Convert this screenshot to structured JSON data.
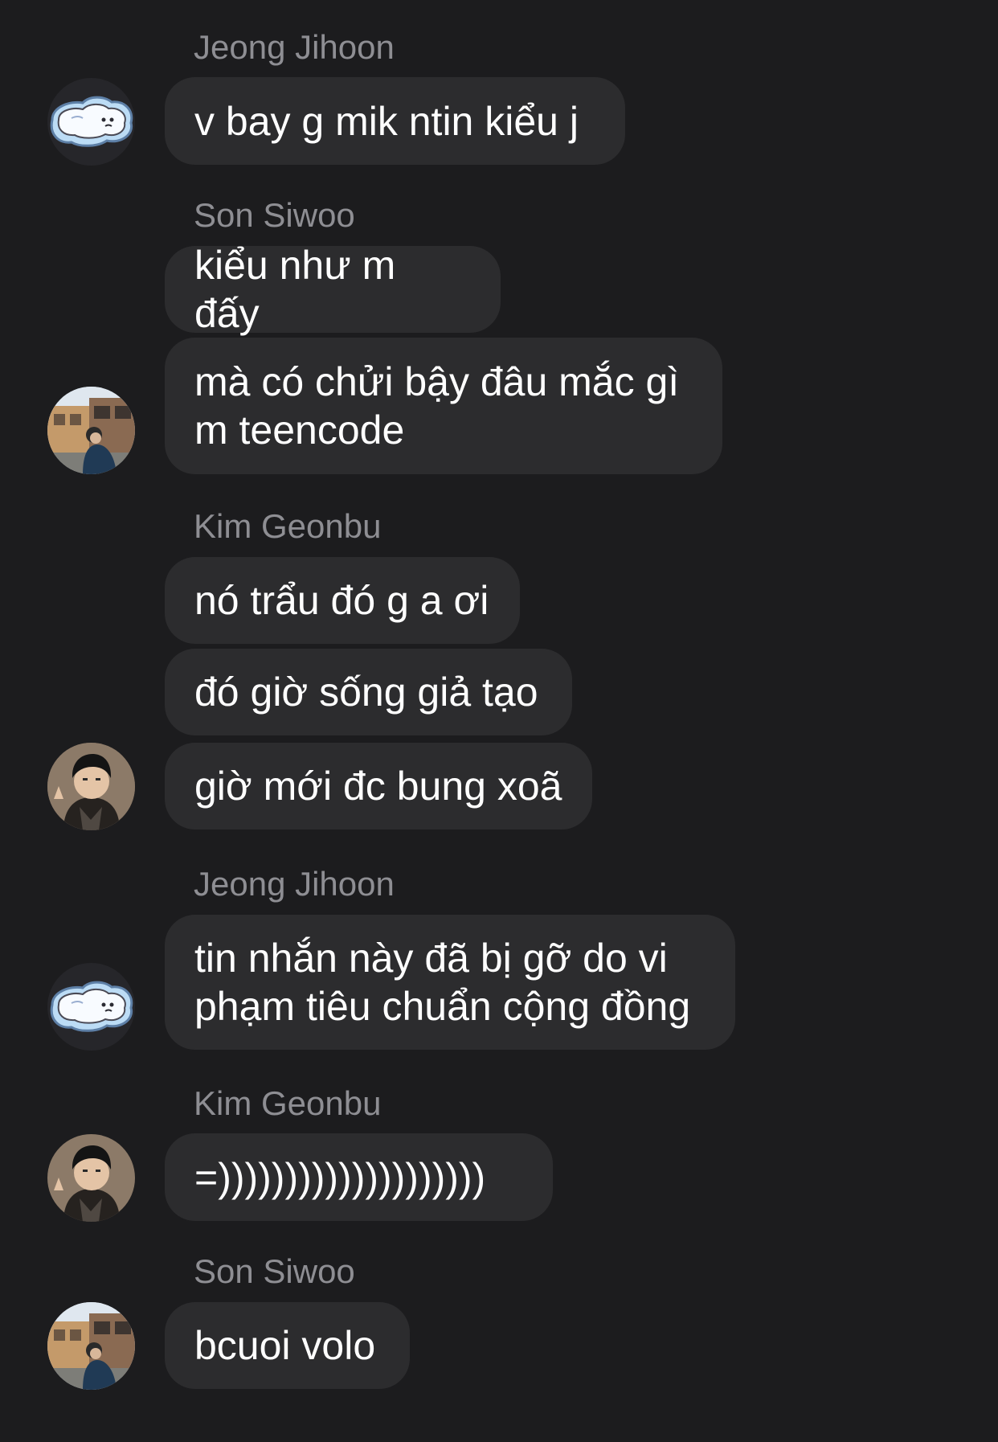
{
  "messages": [
    {
      "sender": "Jeong Jihoon",
      "text": "v bay g mik ntin kiểu j"
    },
    {
      "sender": "Son Siwoo",
      "text": "kiểu như m đấy"
    },
    {
      "text": "mà có chửi bậy đâu mắc gì\nm teencode"
    },
    {
      "sender": "Kim Geonbu",
      "text": "nó trẩu đó g a ơi"
    },
    {
      "text": "đó giờ sống giả tạo"
    },
    {
      "text": "giờ mới đc bung xoã"
    },
    {
      "sender": "Jeong Jihoon",
      "text": "tin nhắn này đã bị gỡ do vi\nphạm tiêu chuẩn cộng đồng"
    },
    {
      "sender": "Kim Geonbu",
      "text": "=))))))))))))))))))))"
    },
    {
      "sender": "Son Siwoo",
      "text": "bcuoi volo"
    }
  ],
  "avatars": {
    "jeong_jihoon": "cartoon-cloud-avatar",
    "son_siwoo": "street-photo-avatar",
    "kim_geonbu": "portrait-photo-avatar"
  },
  "colors": {
    "background": "#1c1c1e",
    "bubble": "#2c2c2e",
    "sender_name": "#8e8e93",
    "text": "#ffffff"
  }
}
